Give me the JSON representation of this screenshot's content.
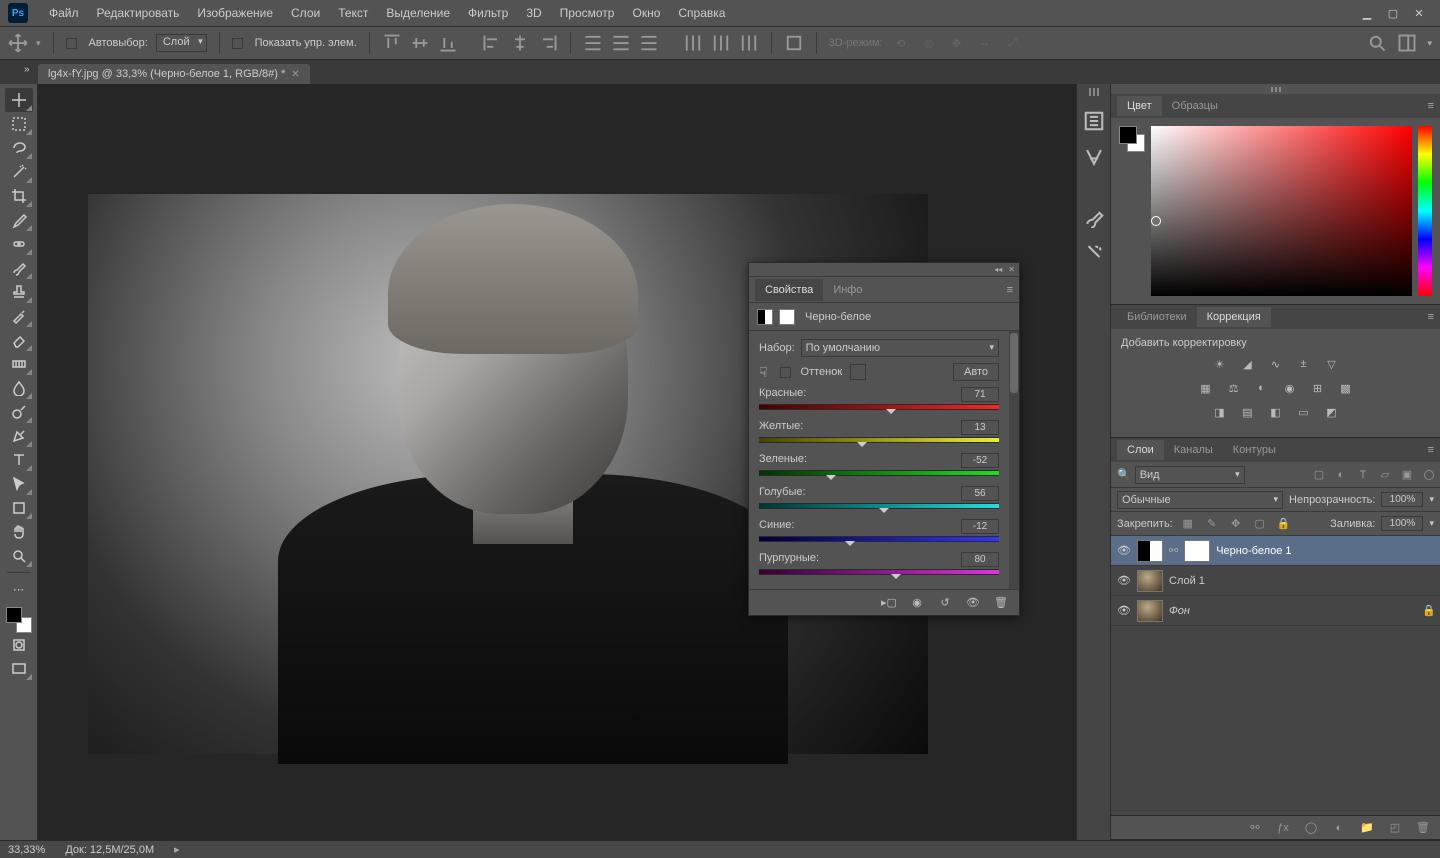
{
  "menu": [
    "Файл",
    "Редактировать",
    "Изображение",
    "Слои",
    "Текст",
    "Выделение",
    "Фильтр",
    "3D",
    "Просмотр",
    "Окно",
    "Справка"
  ],
  "options": {
    "auto_select_label": "Автовыбор:",
    "auto_select_value": "Слой",
    "show_controls_label": "Показать упр. элем.",
    "mode3d": "3D-режим:"
  },
  "doc_tab": "lg4x-fY.jpg @ 33,3% (Черно-белое 1, RGB/8#) *",
  "properties": {
    "tab_props": "Свойства",
    "tab_info": "Инфо",
    "title": "Черно-белое",
    "preset_label": "Набор:",
    "preset_value": "По умолчанию",
    "tint_label": "Оттенок",
    "auto": "Авто",
    "sliders": [
      {
        "label": "Красные:",
        "value": "71",
        "pos": 55,
        "cls": "red-bar"
      },
      {
        "label": "Желтые:",
        "value": "13",
        "pos": 43,
        "cls": "yel-bar"
      },
      {
        "label": "Зеленые:",
        "value": "-52",
        "pos": 30,
        "cls": "grn-bar"
      },
      {
        "label": "Голубые:",
        "value": "56",
        "pos": 52,
        "cls": "cyn-bar"
      },
      {
        "label": "Синие:",
        "value": "-12",
        "pos": 38,
        "cls": "blu-bar"
      },
      {
        "label": "Пурпурные:",
        "value": "80",
        "pos": 57,
        "cls": "mag-bar"
      }
    ]
  },
  "right": {
    "color_tab": "Цвет",
    "swatches_tab": "Образцы",
    "lib_tab": "Библиотеки",
    "adj_tab": "Коррекция",
    "adj_label": "Добавить корректировку",
    "layers_tab": "Слои",
    "channels_tab": "Каналы",
    "paths_tab": "Контуры",
    "filter_label": "Вид",
    "blend_value": "Обычные",
    "opacity_label": "Непрозрачность:",
    "opacity_value": "100%",
    "lock_label": "Закрепить:",
    "fill_label": "Заливка:",
    "fill_value": "100%",
    "layers": [
      {
        "name": "Черно-белое 1",
        "adj": true,
        "sel": true
      },
      {
        "name": "Слой 1",
        "adj": false,
        "sel": false
      },
      {
        "name": "Фон",
        "adj": false,
        "sel": false,
        "locked": true,
        "italic": true
      }
    ]
  },
  "status": {
    "zoom": "33,33%",
    "doc": "Док: 12,5M/25,0M"
  }
}
